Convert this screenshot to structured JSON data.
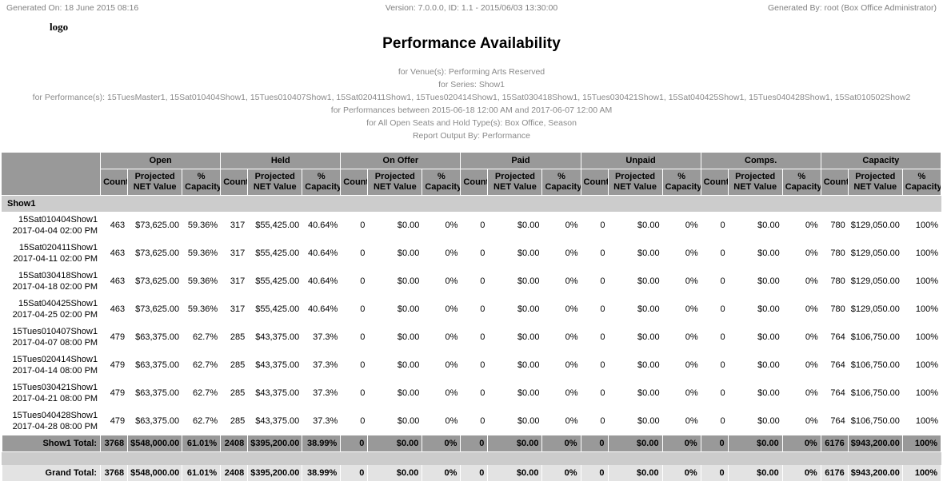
{
  "header": {
    "generated_on": "Generated On: 18 June 2015 08:16",
    "version": "Version: 7.0.0.0, ID: 1.1 - 2015/06/03 13:30:00",
    "generated_by": "Generated By: root (Box Office Administrator)",
    "logo": "logo"
  },
  "report": {
    "title": "Performance Availability",
    "subtitles": [
      "for Venue(s): Performing Arts Reserved",
      "for Series: Show1",
      "for Performance(s): 15TuesMaster1, 15Sat010404Show1, 15Tues010407Show1, 15Sat020411Show1, 15Tues020414Show1, 15Sat030418Show1, 15Tues030421Show1, 15Sat040425Show1, 15Tues040428Show1, 15Sat010502Show2",
      "for Performances between 2015-06-18 12:00 AM and 2017-06-07 12:00 AM",
      "for All Open Seats and Hold Type(s): Box Office, Season",
      "Report Output By: Performance"
    ]
  },
  "table": {
    "group_headers": [
      "Open",
      "Held",
      "On Offer",
      "Paid",
      "Unpaid",
      "Comps.",
      "Capacity"
    ],
    "sub_headers": [
      "Count",
      "Projected NET Value",
      "% Capacity"
    ],
    "sub_header_lines": [
      [
        "Count",
        ""
      ],
      [
        "Projected",
        "NET Value"
      ],
      [
        "%",
        "Capacity"
      ]
    ],
    "group_label": "Show1",
    "rows": [
      {
        "name": "15Sat010404Show1",
        "datetime": "2017-04-04 02:00 PM",
        "cells": [
          "463",
          "$73,625.00",
          "59.36%",
          "317",
          "$55,425.00",
          "40.64%",
          "0",
          "$0.00",
          "0%",
          "0",
          "$0.00",
          "0%",
          "0",
          "$0.00",
          "0%",
          "0",
          "$0.00",
          "0%",
          "780",
          "$129,050.00",
          "100%"
        ]
      },
      {
        "name": "15Sat020411Show1",
        "datetime": "2017-04-11 02:00 PM",
        "cells": [
          "463",
          "$73,625.00",
          "59.36%",
          "317",
          "$55,425.00",
          "40.64%",
          "0",
          "$0.00",
          "0%",
          "0",
          "$0.00",
          "0%",
          "0",
          "$0.00",
          "0%",
          "0",
          "$0.00",
          "0%",
          "780",
          "$129,050.00",
          "100%"
        ]
      },
      {
        "name": "15Sat030418Show1",
        "datetime": "2017-04-18 02:00 PM",
        "cells": [
          "463",
          "$73,625.00",
          "59.36%",
          "317",
          "$55,425.00",
          "40.64%",
          "0",
          "$0.00",
          "0%",
          "0",
          "$0.00",
          "0%",
          "0",
          "$0.00",
          "0%",
          "0",
          "$0.00",
          "0%",
          "780",
          "$129,050.00",
          "100%"
        ]
      },
      {
        "name": "15Sat040425Show1",
        "datetime": "2017-04-25 02:00 PM",
        "cells": [
          "463",
          "$73,625.00",
          "59.36%",
          "317",
          "$55,425.00",
          "40.64%",
          "0",
          "$0.00",
          "0%",
          "0",
          "$0.00",
          "0%",
          "0",
          "$0.00",
          "0%",
          "0",
          "$0.00",
          "0%",
          "780",
          "$129,050.00",
          "100%"
        ]
      },
      {
        "name": "15Tues010407Show1",
        "datetime": "2017-04-07 08:00 PM",
        "cells": [
          "479",
          "$63,375.00",
          "62.7%",
          "285",
          "$43,375.00",
          "37.3%",
          "0",
          "$0.00",
          "0%",
          "0",
          "$0.00",
          "0%",
          "0",
          "$0.00",
          "0%",
          "0",
          "$0.00",
          "0%",
          "764",
          "$106,750.00",
          "100%"
        ]
      },
      {
        "name": "15Tues020414Show1",
        "datetime": "2017-04-14 08:00 PM",
        "cells": [
          "479",
          "$63,375.00",
          "62.7%",
          "285",
          "$43,375.00",
          "37.3%",
          "0",
          "$0.00",
          "0%",
          "0",
          "$0.00",
          "0%",
          "0",
          "$0.00",
          "0%",
          "0",
          "$0.00",
          "0%",
          "764",
          "$106,750.00",
          "100%"
        ]
      },
      {
        "name": "15Tues030421Show1",
        "datetime": "2017-04-21 08:00 PM",
        "cells": [
          "479",
          "$63,375.00",
          "62.7%",
          "285",
          "$43,375.00",
          "37.3%",
          "0",
          "$0.00",
          "0%",
          "0",
          "$0.00",
          "0%",
          "0",
          "$0.00",
          "0%",
          "0",
          "$0.00",
          "0%",
          "764",
          "$106,750.00",
          "100%"
        ]
      },
      {
        "name": "15Tues040428Show1",
        "datetime": "2017-04-28 08:00 PM",
        "cells": [
          "479",
          "$63,375.00",
          "62.7%",
          "285",
          "$43,375.00",
          "37.3%",
          "0",
          "$0.00",
          "0%",
          "0",
          "$0.00",
          "0%",
          "0",
          "$0.00",
          "0%",
          "0",
          "$0.00",
          "0%",
          "764",
          "$106,750.00",
          "100%"
        ]
      }
    ],
    "show_total": {
      "label": "Show1 Total:",
      "cells": [
        "3768",
        "$548,000.00",
        "61.01%",
        "2408",
        "$395,200.00",
        "38.99%",
        "0",
        "$0.00",
        "0%",
        "0",
        "$0.00",
        "0%",
        "0",
        "$0.00",
        "0%",
        "0",
        "$0.00",
        "0%",
        "6176",
        "$943,200.00",
        "100%"
      ]
    },
    "grand_total": {
      "label": "Grand Total:",
      "cells": [
        "3768",
        "$548,000.00",
        "61.01%",
        "2408",
        "$395,200.00",
        "38.99%",
        "0",
        "$0.00",
        "0%",
        "0",
        "$0.00",
        "0%",
        "0",
        "$0.00",
        "0%",
        "0",
        "$0.00",
        "0%",
        "6176",
        "$943,200.00",
        "100%"
      ]
    }
  },
  "colors": {
    "header_grey": "#999999",
    "group_grey": "#cccccc",
    "grand_grey": "#e3e3e3",
    "meta_text": "#808080"
  }
}
